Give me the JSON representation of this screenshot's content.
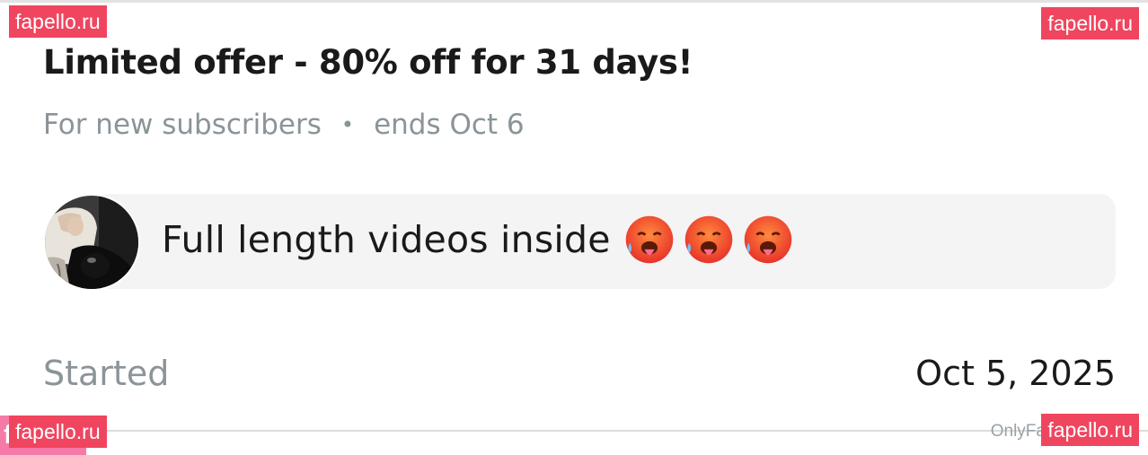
{
  "offer": {
    "title": "Limited offer - 80% off for 31 days!",
    "audience": "For new subscribers",
    "separator": "•",
    "ends": "ends Oct 6"
  },
  "message": {
    "text": "Full length videos inside",
    "emoji": [
      "hot-face-emoji",
      "hot-face-emoji",
      "hot-face-emoji"
    ]
  },
  "status": {
    "started_label": "Started",
    "started_date": "Oct 5, 2025"
  },
  "watermarks": {
    "top_left": "fapello.ru",
    "top_right": "fapello.ru",
    "bottom_left_back": "f        .com",
    "bottom_left": "fapello.ru",
    "bottom_right": "fapello.ru",
    "source": "OnlyFans.com/c"
  },
  "colors": {
    "watermark": "#f0455f",
    "muted_text": "#8a9499",
    "bubble_bg": "#f4f4f5"
  }
}
